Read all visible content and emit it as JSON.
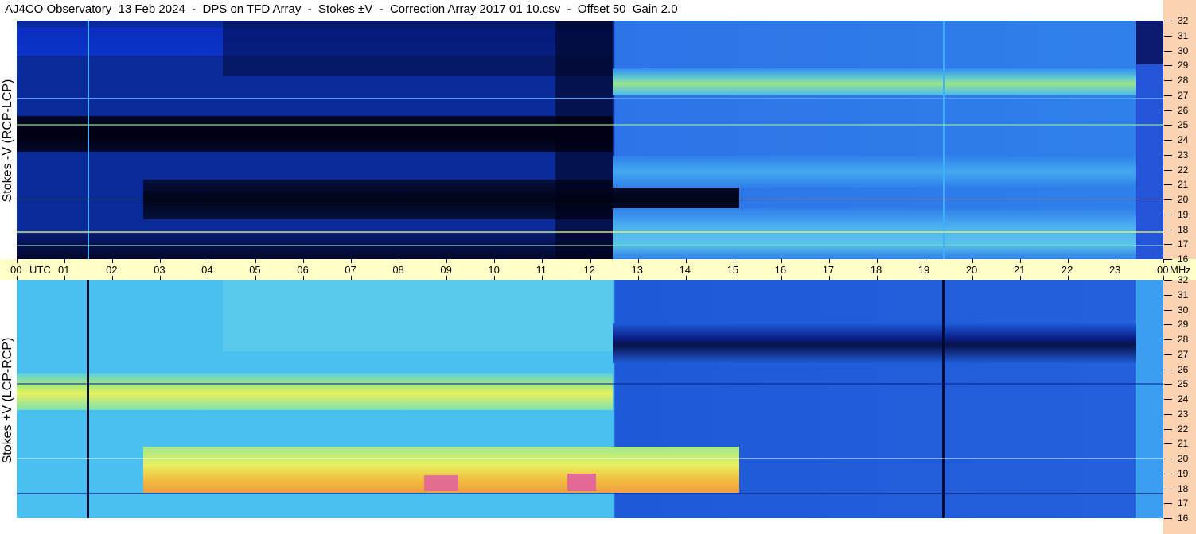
{
  "header": {
    "title": "AJ4CO Observatory  13 Feb 2024  -  DPS on TFD Array  -  Stokes ±V  -  Correction Array 2017 01 10.csv  -  Offset 50  Gain 2.0"
  },
  "chart_data": [
    {
      "type": "heatmap",
      "ylabel": "Stokes -V (RCP-LCP)",
      "x_ticks": [
        "00",
        "UTC",
        "01",
        "02",
        "03",
        "04",
        "05",
        "06",
        "07",
        "08",
        "09",
        "10",
        "11",
        "12",
        "13",
        "14",
        "15",
        "16",
        "17",
        "18",
        "19",
        "20",
        "21",
        "22",
        "23",
        "00",
        "MHz"
      ],
      "y_ticks": [
        "32",
        "31",
        "30",
        "29",
        "28",
        "27",
        "26",
        "25",
        "24",
        "23",
        "22",
        "21",
        "20",
        "19",
        "18",
        "17",
        "16"
      ],
      "ylim": [
        16,
        32
      ],
      "xlim": [
        0,
        24
      ],
      "colormap": [
        "#000010",
        "#0a1a80",
        "#1f54e0",
        "#2f8cf0",
        "#49c0f0",
        "#7de0b0",
        "#e8f060",
        "#f0a040",
        "#e060a0"
      ]
    },
    {
      "type": "heatmap",
      "ylabel": "Stokes +V (LCP-RCP)",
      "x_ticks": [
        "00",
        "UTC",
        "01",
        "02",
        "03",
        "04",
        "05",
        "06",
        "07",
        "08",
        "09",
        "10",
        "11",
        "12",
        "13",
        "14",
        "15",
        "16",
        "17",
        "18",
        "19",
        "20",
        "21",
        "22",
        "23",
        "00",
        "MHz"
      ],
      "y_ticks": [
        "32",
        "31",
        "30",
        "29",
        "28",
        "27",
        "26",
        "25",
        "24",
        "23",
        "22",
        "21",
        "20",
        "19",
        "18",
        "17",
        "16"
      ],
      "ylim": [
        16,
        32
      ],
      "xlim": [
        0,
        24
      ],
      "colormap": [
        "#000010",
        "#0a1a80",
        "#1f54e0",
        "#2f8cf0",
        "#49c0f0",
        "#7de0b0",
        "#e8f060",
        "#f0a040",
        "#e060a0"
      ]
    }
  ]
}
